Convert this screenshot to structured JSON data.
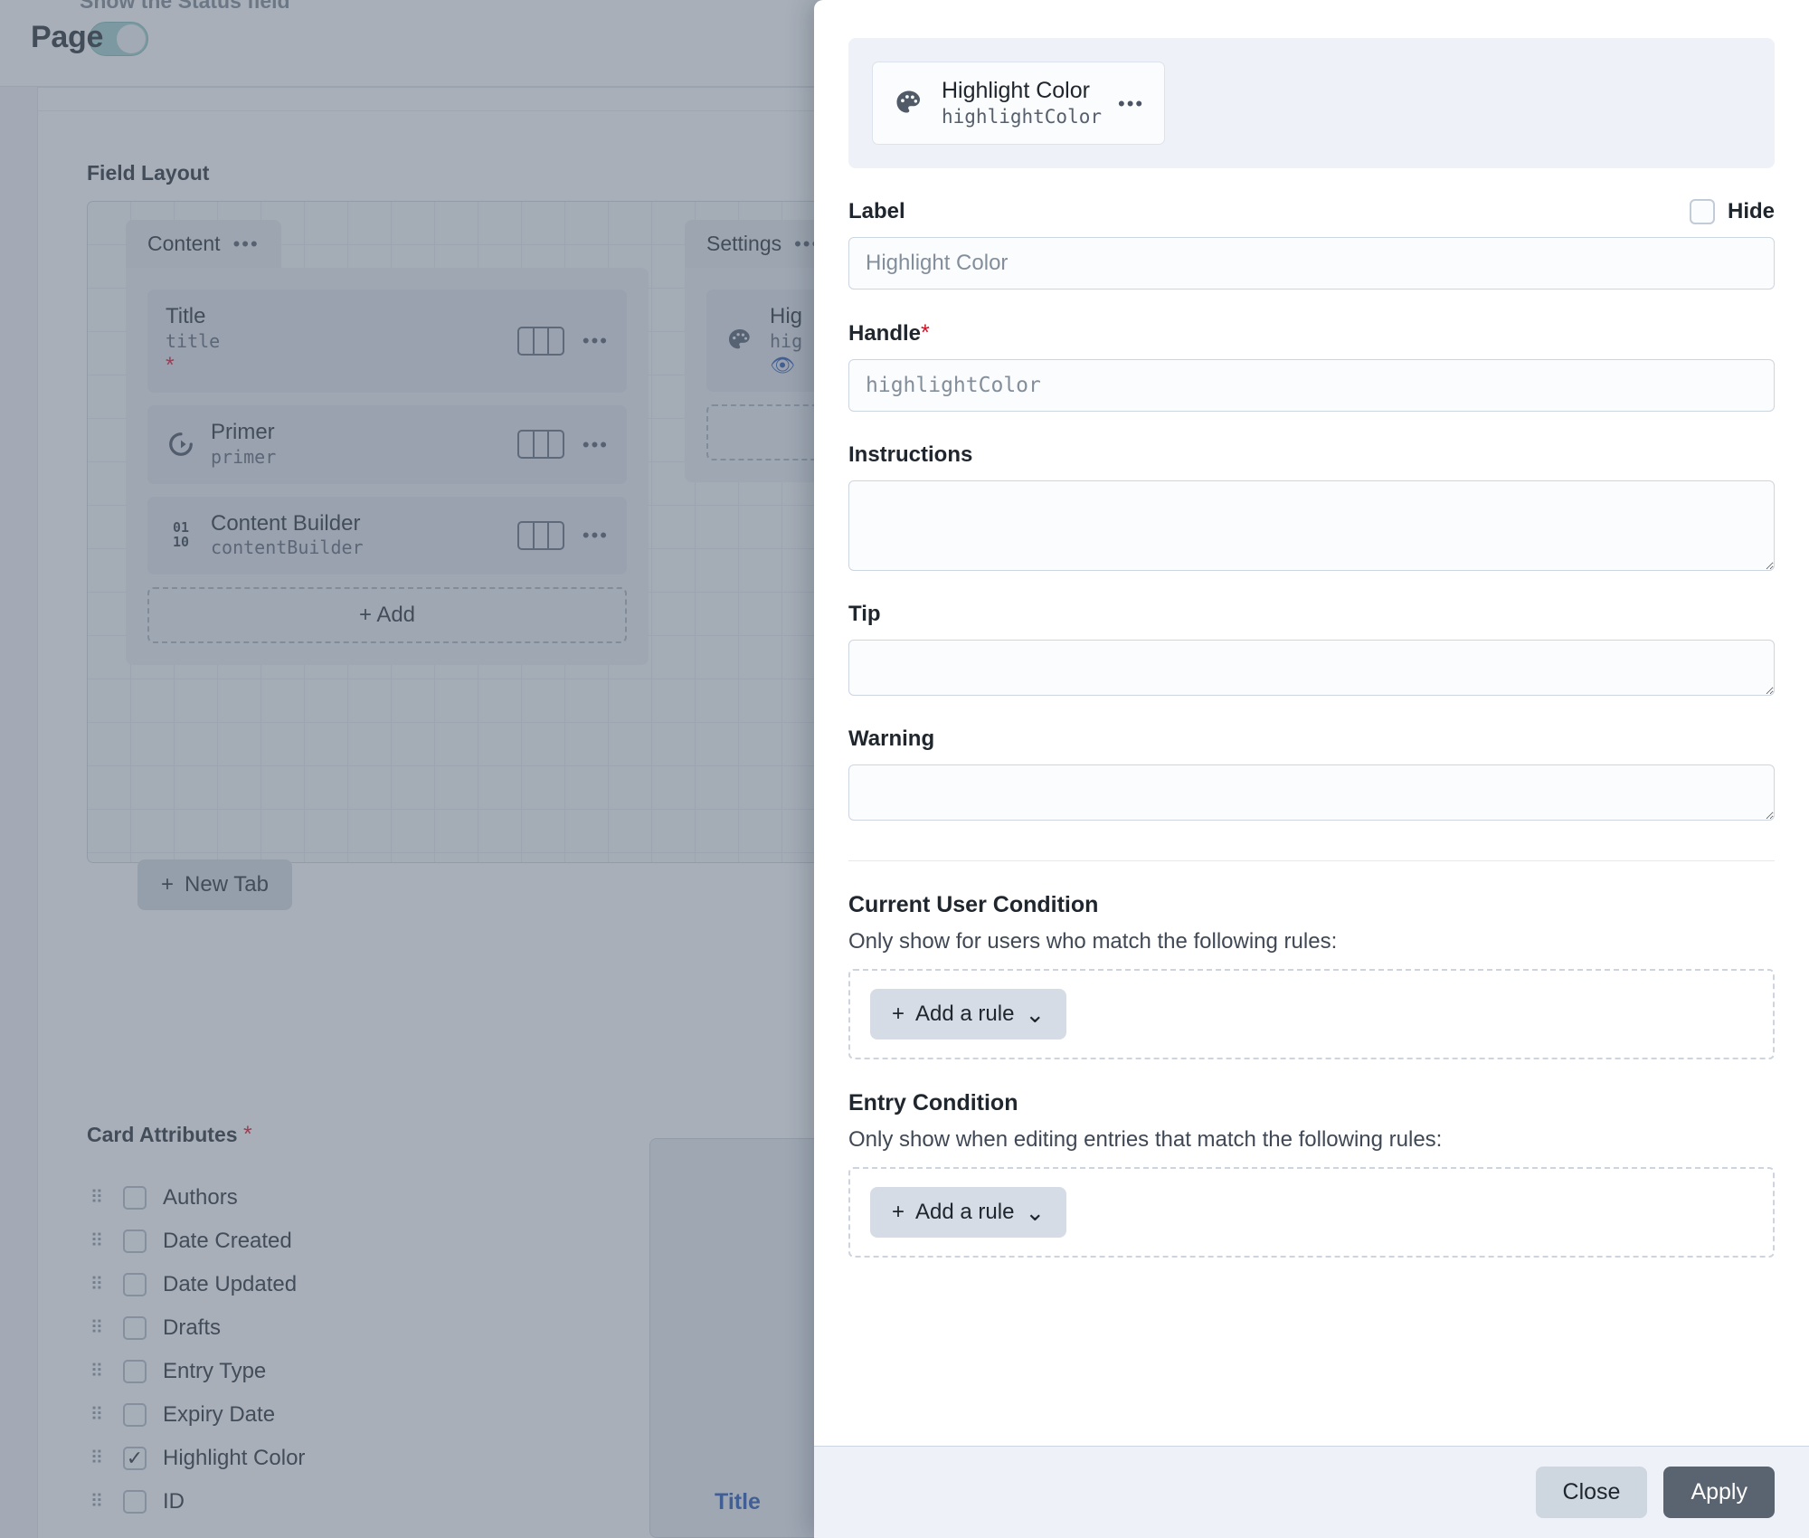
{
  "background": {
    "status_field_label": "Show the Status field",
    "page_heading": "Page",
    "field_layout_title": "Field Layout",
    "field_layout_required": "*",
    "tabs": [
      {
        "name": "Content",
        "menu_icon": "•••",
        "fields": [
          {
            "name": "Title",
            "handle": "title",
            "icon": "none",
            "required": "*",
            "width_icon": "width-indicator"
          },
          {
            "name": "Primer",
            "handle": "primer",
            "icon": "entry-icon",
            "required": "",
            "width_icon": "width-indicator"
          },
          {
            "name": "Content Builder",
            "handle": "contentBuilder",
            "icon": "matrix-icon",
            "required": "",
            "width_icon": "width-indicator"
          }
        ],
        "add_label": "+ Add"
      },
      {
        "name": "Settings",
        "menu_icon": "•••",
        "fields": [
          {
            "name": "Hig",
            "handle": "hig",
            "icon": "palette-icon",
            "required": "",
            "eye": "visible-icon"
          }
        ],
        "add_label": ""
      }
    ],
    "new_tab_label": "New Tab",
    "new_tab_plus": "+",
    "card_attributes_title": "Card Attributes",
    "card_attributes_required": "*",
    "card_attributes": [
      {
        "label": "Authors",
        "checked": false
      },
      {
        "label": "Date Created",
        "checked": false
      },
      {
        "label": "Date Updated",
        "checked": false
      },
      {
        "label": "Drafts",
        "checked": false
      },
      {
        "label": "Entry Type",
        "checked": false
      },
      {
        "label": "Expiry Date",
        "checked": false
      },
      {
        "label": "Highlight Color",
        "checked": true
      },
      {
        "label": "ID",
        "checked": false
      }
    ],
    "bottom_title": "Title"
  },
  "modal": {
    "field_card": {
      "icon": "palette-icon",
      "name": "Highlight Color",
      "handle": "highlightColor",
      "menu_icon": "•••"
    },
    "label": {
      "title": "Label",
      "value": "",
      "placeholder": "Highlight Color",
      "hide_label": "Hide",
      "hide_checked": false
    },
    "handle": {
      "title": "Handle",
      "required": "*",
      "value": "",
      "placeholder": "highlightColor"
    },
    "instructions": {
      "title": "Instructions",
      "value": ""
    },
    "tip": {
      "title": "Tip",
      "value": ""
    },
    "warning": {
      "title": "Warning",
      "value": ""
    },
    "current_user_condition": {
      "title": "Current User Condition",
      "description": "Only show for users who match the following rules:",
      "add_rule_label": "Add a rule",
      "add_rule_plus": "+",
      "add_rule_chevron": "⌄"
    },
    "entry_condition": {
      "title": "Entry Condition",
      "description": "Only show when editing entries that match the following rules:",
      "add_rule_label": "Add a rule",
      "add_rule_plus": "+",
      "add_rule_chevron": "⌄"
    },
    "footer": {
      "close_label": "Close",
      "apply_label": "Apply"
    }
  },
  "colors": {
    "accent_blue": "#1d4fb0",
    "required_red": "#cf1124",
    "apply_button": "#5a6471",
    "toggle_on": "#9ecfcb",
    "modal_header_bg": "#eef2f8"
  }
}
